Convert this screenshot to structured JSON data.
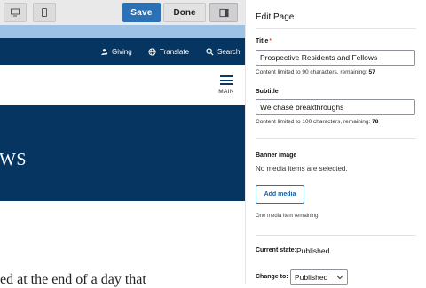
{
  "toolbar": {
    "save_label": "Save",
    "done_label": "Done",
    "icons": [
      "desktop-icon",
      "mobile-icon",
      "sidebar-toggle-icon"
    ],
    "accent": "#2a72b5"
  },
  "site": {
    "nav": [
      {
        "label": "Giving",
        "icon": "giving-icon"
      },
      {
        "label": "Translate",
        "icon": "globe-icon"
      },
      {
        "label": "Search",
        "icon": "search-icon"
      }
    ],
    "menu_label": "MAIN",
    "hero_text": "WS",
    "body_text": "ed at the end of a day that",
    "brand_color": "#053560"
  },
  "panel": {
    "title": "Edit Page",
    "title_field": {
      "label": "Title",
      "required_marker": "*",
      "value": "Prospective Residents and Fellows",
      "hint_prefix": "Content limited to 90 characters, remaining:",
      "remaining": "57"
    },
    "subtitle_field": {
      "label": "Subtitle",
      "value": "We chase breakthroughs",
      "hint_prefix": "Content limited to 100 characters, remaining:",
      "remaining": "78"
    },
    "banner": {
      "label": "Banner image",
      "empty_text": "No media items are selected.",
      "add_label": "Add media",
      "remaining_text": "One media item remaining."
    },
    "state": {
      "label": "Current state:",
      "value": "Published"
    },
    "change_to": {
      "label": "Change to:",
      "selected": "Published"
    }
  }
}
